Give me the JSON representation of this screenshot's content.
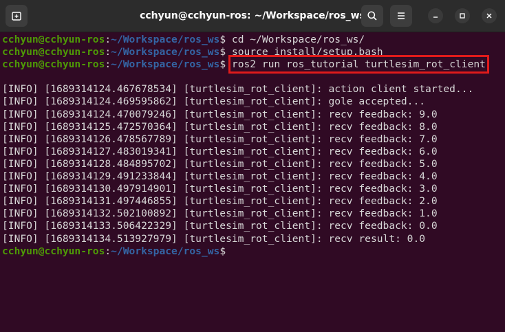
{
  "window": {
    "title": "cchyun@cchyun-ros: ~/Workspace/ros_ws",
    "buttons": {
      "new_tab_icon": "new-tab-icon",
      "search_icon": "search-icon",
      "menu_icon": "hamburger-menu-icon",
      "minimize_icon": "minimize-icon",
      "maximize_icon": "maximize-icon",
      "close_icon": "close-icon"
    }
  },
  "colors": {
    "background": "#300a24",
    "user": "#4e9a06",
    "path": "#3465a4",
    "text": "#d7d7d7",
    "highlight_box": "#e01b1b"
  },
  "prompt": {
    "user_host": "cchyun@cchyun-ros",
    "separator": ":",
    "path": "~/Workspace/ros_ws",
    "symbol": "$"
  },
  "commands": [
    " cd ~/Workspace/ros_ws/",
    " source install/setup.bash",
    "ros2 run ros_tutorial turtlesim_rot_client"
  ],
  "output": [
    "[INFO] [1689314124.467678534] [turtlesim_rot_client]: action client started...",
    "[INFO] [1689314124.469595862] [turtlesim_rot_client]: gole accepted...",
    "[INFO] [1689314124.470079246] [turtlesim_rot_client]: recv feedback: 9.0",
    "[INFO] [1689314125.472570364] [turtlesim_rot_client]: recv feedback: 8.0",
    "[INFO] [1689314126.478567789] [turtlesim_rot_client]: recv feedback: 7.0",
    "[INFO] [1689314127.483019341] [turtlesim_rot_client]: recv feedback: 6.0",
    "[INFO] [1689314128.484895702] [turtlesim_rot_client]: recv feedback: 5.0",
    "[INFO] [1689314129.491233844] [turtlesim_rot_client]: recv feedback: 4.0",
    "[INFO] [1689314130.497914901] [turtlesim_rot_client]: recv feedback: 3.0",
    "[INFO] [1689314131.497446855] [turtlesim_rot_client]: recv feedback: 2.0",
    "[INFO] [1689314132.502100892] [turtlesim_rot_client]: recv feedback: 1.0",
    "[INFO] [1689314133.506422329] [turtlesim_rot_client]: recv feedback: 0.0",
    "[INFO] [1689314134.513927979] [turtlesim_rot_client]: recv result: 0.0"
  ]
}
